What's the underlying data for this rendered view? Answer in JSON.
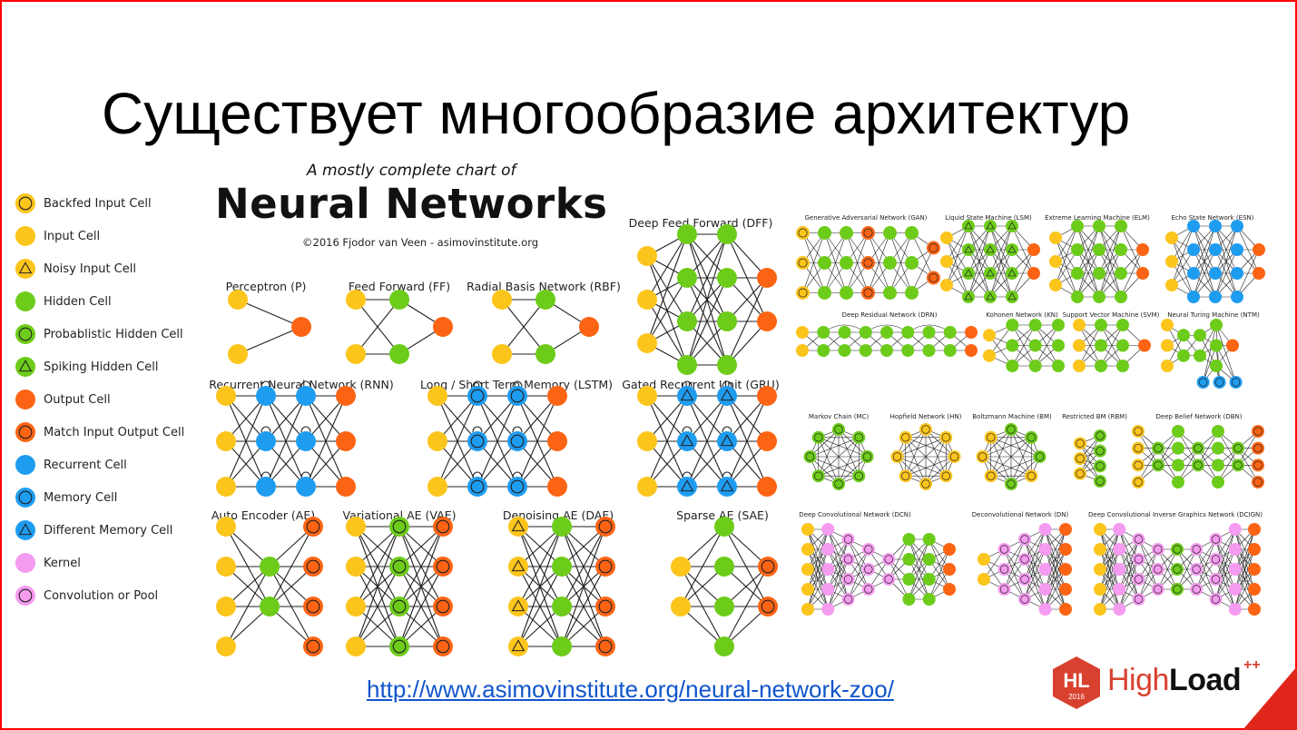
{
  "slide": {
    "title": "Существует многообразие архитектур",
    "url": "http://www.asimovinstitute.org/neural-network-zoo/",
    "accent_color": "#ff0000"
  },
  "chart": {
    "subtitle": "A mostly complete chart of",
    "title": "Neural Networks",
    "copyright": "©2016 Fjodor van Veen - asimovinstitute.org"
  },
  "colors": {
    "input": "#fcc51c",
    "hidden": "#6dcc1a",
    "output": "#fc6414",
    "recurrent": "#1e9cf0",
    "kernel": "#f59bf0",
    "edge": "#222222"
  },
  "legend": [
    {
      "label": "Backfed Input Cell",
      "cell": "backfed"
    },
    {
      "label": "Input Cell",
      "cell": "input"
    },
    {
      "label": "Noisy Input Cell",
      "cell": "noisy"
    },
    {
      "label": "Hidden Cell",
      "cell": "hidden"
    },
    {
      "label": "Probablistic Hidden Cell",
      "cell": "prob"
    },
    {
      "label": "Spiking Hidden Cell",
      "cell": "spike"
    },
    {
      "label": "Output Cell",
      "cell": "output"
    },
    {
      "label": "Match Input Output Cell",
      "cell": "match"
    },
    {
      "label": "Recurrent Cell",
      "cell": "recurrent"
    },
    {
      "label": "Memory Cell",
      "cell": "memory"
    },
    {
      "label": "Different Memory Cell",
      "cell": "diffmem"
    },
    {
      "label": "Kernel",
      "cell": "kernel"
    },
    {
      "label": "Convolution or Pool",
      "cell": "conv"
    }
  ],
  "networks": [
    {
      "name": "Perceptron (P)",
      "layers": [
        [
          "input",
          "input"
        ],
        [
          "output"
        ]
      ]
    },
    {
      "name": "Feed Forward (FF)",
      "layers": [
        [
          "input",
          "input"
        ],
        [
          "hidden",
          "hidden"
        ],
        [
          "output"
        ]
      ]
    },
    {
      "name": "Radial Basis Network (RBF)",
      "layers": [
        [
          "input",
          "input"
        ],
        [
          "hidden",
          "hidden"
        ],
        [
          "output"
        ]
      ]
    },
    {
      "name": "Deep Feed Forward (DFF)",
      "layers": [
        [
          "input",
          "input",
          "input"
        ],
        [
          "hidden",
          "hidden",
          "hidden",
          "hidden"
        ],
        [
          "hidden",
          "hidden",
          "hidden",
          "hidden"
        ],
        [
          "output",
          "output"
        ]
      ]
    },
    {
      "name": "Recurrent Neural Network (RNN)",
      "layers": [
        [
          "input",
          "input",
          "input"
        ],
        [
          "recurrent",
          "recurrent",
          "recurrent"
        ],
        [
          "recurrent",
          "recurrent",
          "recurrent"
        ],
        [
          "output",
          "output",
          "output"
        ]
      ]
    },
    {
      "name": "Long / Short Term Memory (LSTM)",
      "layers": [
        [
          "input",
          "input",
          "input"
        ],
        [
          "memory",
          "memory",
          "memory"
        ],
        [
          "memory",
          "memory",
          "memory"
        ],
        [
          "output",
          "output",
          "output"
        ]
      ]
    },
    {
      "name": "Gated Recurrent Unit (GRU)",
      "layers": [
        [
          "input",
          "input",
          "input"
        ],
        [
          "diffmem",
          "diffmem",
          "diffmem"
        ],
        [
          "diffmem",
          "diffmem",
          "diffmem"
        ],
        [
          "output",
          "output",
          "output"
        ]
      ]
    },
    {
      "name": "Auto Encoder (AE)",
      "layers": [
        [
          "input",
          "input",
          "input",
          "input"
        ],
        [
          "hidden",
          "hidden"
        ],
        [
          "match",
          "match",
          "match",
          "match"
        ]
      ]
    },
    {
      "name": "Variational AE (VAE)",
      "layers": [
        [
          "input",
          "input",
          "input",
          "input"
        ],
        [
          "prob",
          "prob",
          "prob",
          "prob"
        ],
        [
          "match",
          "match",
          "match",
          "match"
        ]
      ]
    },
    {
      "name": "Denoising AE (DAE)",
      "layers": [
        [
          "noisy",
          "noisy",
          "noisy",
          "noisy"
        ],
        [
          "hidden",
          "hidden",
          "hidden",
          "hidden"
        ],
        [
          "match",
          "match",
          "match",
          "match"
        ]
      ]
    },
    {
      "name": "Sparse AE (SAE)",
      "layers": [
        [
          "input",
          "input"
        ],
        [
          "hidden",
          "hidden",
          "hidden",
          "hidden"
        ],
        [
          "match",
          "match"
        ]
      ]
    },
    {
      "name": "Generative Adversarial Network (GAN)",
      "layers": [
        [
          "backfed",
          "backfed",
          "backfed"
        ],
        [
          "hidden",
          "hidden",
          "hidden"
        ],
        [
          "hidden",
          "hidden",
          "hidden"
        ],
        [
          "match",
          "match",
          "match"
        ],
        [
          "hidden",
          "hidden",
          "hidden"
        ],
        [
          "hidden",
          "hidden",
          "hidden"
        ],
        [
          "match",
          "match"
        ]
      ]
    },
    {
      "name": "Liquid State Machine (LSM)",
      "layers": [
        [
          "input",
          "input",
          "input"
        ],
        [
          "spike",
          "spike",
          "spike",
          "spike"
        ],
        [
          "spike",
          "spike",
          "spike",
          "spike"
        ],
        [
          "spike",
          "spike",
          "spike",
          "spike"
        ],
        [
          "output",
          "output"
        ]
      ]
    },
    {
      "name": "Extreme Learning Machine (ELM)",
      "layers": [
        [
          "input",
          "input",
          "input"
        ],
        [
          "hidden",
          "hidden",
          "hidden",
          "hidden"
        ],
        [
          "hidden",
          "hidden",
          "hidden",
          "hidden"
        ],
        [
          "hidden",
          "hidden",
          "hidden",
          "hidden"
        ],
        [
          "output",
          "output"
        ]
      ]
    },
    {
      "name": "Echo State Network (ESN)",
      "layers": [
        [
          "input",
          "input",
          "input"
        ],
        [
          "recurrent",
          "recurrent",
          "recurrent",
          "recurrent"
        ],
        [
          "recurrent",
          "recurrent",
          "recurrent",
          "recurrent"
        ],
        [
          "recurrent",
          "recurrent",
          "recurrent",
          "recurrent"
        ],
        [
          "output",
          "output"
        ]
      ]
    },
    {
      "name": "Deep Residual Network (DRN)",
      "layers": [
        [
          "input",
          "input"
        ],
        [
          "hidden",
          "hidden"
        ],
        [
          "hidden",
          "hidden"
        ],
        [
          "hidden",
          "hidden"
        ],
        [
          "hidden",
          "hidden"
        ],
        [
          "hidden",
          "hidden"
        ],
        [
          "hidden",
          "hidden"
        ],
        [
          "hidden",
          "hidden"
        ],
        [
          "output",
          "output"
        ]
      ]
    },
    {
      "name": "Kohonen Network (KN)",
      "layers": [
        [
          "input",
          "input"
        ],
        [
          "hidden",
          "hidden",
          "hidden"
        ],
        [
          "hidden",
          "hidden",
          "hidden"
        ],
        [
          "hidden",
          "hidden",
          "hidden"
        ]
      ]
    },
    {
      "name": "Support Vector Machine (SVM)",
      "layers": [
        [
          "input",
          "input",
          "input"
        ],
        [
          "hidden",
          "hidden",
          "hidden"
        ],
        [
          "hidden",
          "hidden",
          "hidden"
        ],
        [
          "output"
        ]
      ]
    },
    {
      "name": "Neural Turing Machine (NTM)",
      "layers": [
        [
          "input",
          "input",
          "input"
        ],
        [
          "hidden",
          "hidden"
        ],
        [
          "hidden",
          "hidden"
        ],
        [
          "hidden",
          "hidden",
          "hidden"
        ],
        [
          "output"
        ]
      ],
      "memory": [
        "memory",
        "memory",
        "memory"
      ]
    },
    {
      "name": "Markov Chain (MC)",
      "ring": "prob",
      "count": 8
    },
    {
      "name": "Hopfield Network (HN)",
      "ring": "backfed",
      "count": 8
    },
    {
      "name": "Boltzmann Machine (BM)",
      "ring": "mixed",
      "count": 8
    },
    {
      "name": "Restricted BM (RBM)",
      "layers": [
        [
          "backfed",
          "backfed",
          "backfed"
        ],
        [
          "prob",
          "prob",
          "prob",
          "prob"
        ]
      ]
    },
    {
      "name": "Deep Belief Network (DBN)",
      "layers": [
        [
          "backfed",
          "backfed",
          "backfed",
          "backfed"
        ],
        [
          "prob",
          "prob"
        ],
        [
          "hidden",
          "hidden",
          "hidden",
          "hidden"
        ],
        [
          "prob",
          "prob"
        ],
        [
          "hidden",
          "hidden",
          "hidden",
          "hidden"
        ],
        [
          "prob",
          "prob"
        ],
        [
          "match",
          "match",
          "match",
          "match"
        ]
      ]
    },
    {
      "name": "Deep Convolutional Network (DCN)",
      "layers": [
        [
          "input",
          "input",
          "input",
          "input",
          "input"
        ],
        [
          "kernel",
          "kernel",
          "kernel",
          "kernel",
          "kernel"
        ],
        [
          "conv",
          "conv",
          "conv",
          "conv"
        ],
        [
          "conv",
          "conv",
          "conv"
        ],
        [
          "conv",
          "conv"
        ],
        [
          "hidden",
          "hidden",
          "hidden",
          "hidden"
        ],
        [
          "hidden",
          "hidden",
          "hidden",
          "hidden"
        ],
        [
          "output",
          "output",
          "output"
        ]
      ]
    },
    {
      "name": "Deconvolutional Network (DN)",
      "layers": [
        [
          "input",
          "input"
        ],
        [
          "conv",
          "conv",
          "conv"
        ],
        [
          "conv",
          "conv",
          "conv",
          "conv"
        ],
        [
          "kernel",
          "kernel",
          "kernel",
          "kernel",
          "kernel"
        ],
        [
          "output",
          "output",
          "output",
          "output",
          "output"
        ]
      ]
    },
    {
      "name": "Deep Convolutional Inverse Graphics Network (DCIGN)",
      "layers": [
        [
          "input",
          "input",
          "input",
          "input",
          "input"
        ],
        [
          "kernel",
          "kernel",
          "kernel",
          "kernel",
          "kernel"
        ],
        [
          "conv",
          "conv",
          "conv",
          "conv"
        ],
        [
          "conv",
          "conv",
          "conv"
        ],
        [
          "prob",
          "prob",
          "prob"
        ],
        [
          "conv",
          "conv",
          "conv"
        ],
        [
          "conv",
          "conv",
          "conv",
          "conv"
        ],
        [
          "kernel",
          "kernel",
          "kernel",
          "kernel",
          "kernel"
        ],
        [
          "output",
          "output",
          "output",
          "output",
          "output"
        ]
      ]
    }
  ],
  "logo": {
    "badge": "HL",
    "year": "2016",
    "name_light": "High",
    "name_bold": "Load",
    "suffix": "++",
    "color": "#d8412f"
  }
}
